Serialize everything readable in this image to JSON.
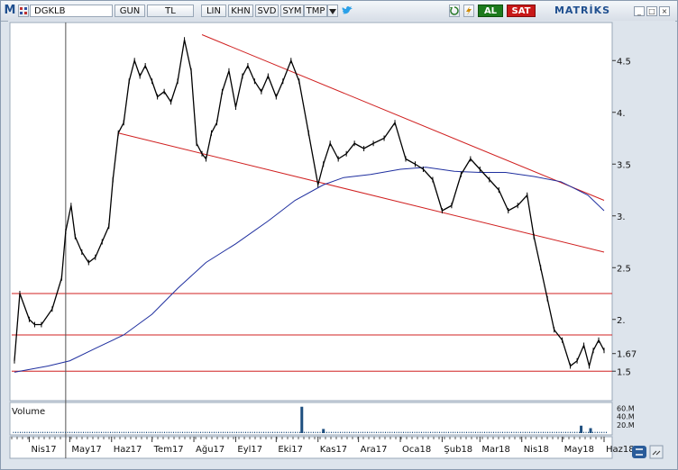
{
  "toolbar": {
    "logo": "M",
    "symbol": "DGKLB",
    "period": "GUN",
    "currency": "TL",
    "buttons": [
      "LIN",
      "KHN",
      "SVD",
      "SYM",
      "TMP"
    ],
    "buy_label": "AL",
    "sell_label": "SAT",
    "brand": "MATRİKS",
    "refresh_icon": "refresh-icon",
    "twitter_icon": "twitter-bird-icon",
    "colors": {
      "buy": "#1c7a1c",
      "sell": "#c81818",
      "accent": "#1f4f8f"
    }
  },
  "chart_data": [
    {
      "type": "line",
      "series": [
        {
          "role": "price",
          "color": "#000000",
          "x": [
            "2017-03-21",
            "2017-03-25",
            "2017-04-01",
            "2017-04-05",
            "2017-04-10",
            "2017-04-18",
            "2017-04-25",
            "2017-04-28",
            "2017-05-02",
            "2017-05-05",
            "2017-05-10",
            "2017-05-15",
            "2017-05-20",
            "2017-05-25",
            "2017-05-30",
            "2017-06-02",
            "2017-06-06",
            "2017-06-10",
            "2017-06-14",
            "2017-06-18",
            "2017-06-22",
            "2017-06-26",
            "2017-07-01",
            "2017-07-05",
            "2017-07-10",
            "2017-07-15",
            "2017-07-20",
            "2017-07-25",
            "2017-07-30",
            "2017-08-03",
            "2017-08-07",
            "2017-08-10",
            "2017-08-14",
            "2017-08-18",
            "2017-08-22",
            "2017-08-27",
            "2017-09-01",
            "2017-09-06",
            "2017-09-10",
            "2017-09-15",
            "2017-09-20",
            "2017-09-25",
            "2017-10-01",
            "2017-10-06",
            "2017-10-12",
            "2017-10-18",
            "2017-10-25",
            "2017-11-01",
            "2017-11-05",
            "2017-11-10",
            "2017-11-16",
            "2017-11-22",
            "2017-11-28",
            "2017-12-05",
            "2017-12-12",
            "2017-12-20",
            "2017-12-28",
            "2018-01-05",
            "2018-01-12",
            "2018-01-18",
            "2018-01-25",
            "2018-02-01",
            "2018-02-08",
            "2018-02-15",
            "2018-02-22",
            "2018-03-01",
            "2018-03-08",
            "2018-03-15",
            "2018-03-22",
            "2018-03-29",
            "2018-04-05",
            "2018-04-10",
            "2018-04-15",
            "2018-04-20",
            "2018-04-25",
            "2018-05-01",
            "2018-05-07",
            "2018-05-12",
            "2018-05-17",
            "2018-05-21",
            "2018-05-24",
            "2018-05-28",
            "2018-06-01"
          ],
          "values": [
            1.6,
            2.25,
            2.0,
            1.95,
            1.95,
            2.1,
            2.4,
            2.85,
            3.1,
            2.8,
            2.65,
            2.55,
            2.6,
            2.75,
            2.9,
            3.35,
            3.8,
            3.9,
            4.3,
            4.5,
            4.35,
            4.45,
            4.3,
            4.15,
            4.2,
            4.1,
            4.3,
            4.7,
            4.4,
            3.7,
            3.6,
            3.55,
            3.8,
            3.9,
            4.2,
            4.4,
            4.05,
            4.35,
            4.45,
            4.3,
            4.2,
            4.35,
            4.15,
            4.3,
            4.5,
            4.3,
            3.8,
            3.3,
            3.5,
            3.7,
            3.55,
            3.6,
            3.7,
            3.65,
            3.7,
            3.75,
            3.9,
            3.55,
            3.5,
            3.45,
            3.35,
            3.05,
            3.1,
            3.4,
            3.55,
            3.45,
            3.35,
            3.25,
            3.05,
            3.1,
            3.2,
            2.8,
            2.5,
            2.2,
            1.9,
            1.8,
            1.55,
            1.6,
            1.75,
            1.55,
            1.7,
            1.8,
            1.7
          ]
        },
        {
          "role": "moving-average",
          "color": "#1f2f9f",
          "x": [
            "2017-03-21",
            "2017-04-15",
            "2017-05-01",
            "2017-05-20",
            "2017-06-10",
            "2017-07-01",
            "2017-07-20",
            "2017-08-10",
            "2017-09-01",
            "2017-09-25",
            "2017-10-15",
            "2017-11-05",
            "2017-11-20",
            "2017-12-10",
            "2018-01-01",
            "2018-01-20",
            "2018-02-10",
            "2018-03-01",
            "2018-03-20",
            "2018-04-10",
            "2018-04-30",
            "2018-05-20",
            "2018-06-01"
          ],
          "values": [
            1.49,
            1.55,
            1.6,
            1.72,
            1.85,
            2.05,
            2.3,
            2.55,
            2.73,
            2.95,
            3.15,
            3.3,
            3.37,
            3.4,
            3.45,
            3.47,
            3.43,
            3.42,
            3.42,
            3.38,
            3.33,
            3.2,
            3.05
          ]
        }
      ],
      "reference_lines": [
        {
          "kind": "horizontal",
          "y": 2.25,
          "color": "#d02020"
        },
        {
          "kind": "horizontal",
          "y": 1.85,
          "color": "#d02020"
        },
        {
          "kind": "horizontal",
          "y": 1.5,
          "color": "#d02020"
        },
        {
          "kind": "trend",
          "from": [
            "2017-08-07",
            4.75
          ],
          "to": [
            "2018-06-01",
            3.15
          ],
          "color": "#d02020"
        },
        {
          "kind": "trend",
          "from": [
            "2017-06-06",
            3.8
          ],
          "to": [
            "2018-06-01",
            2.65
          ],
          "color": "#d02020"
        },
        {
          "kind": "vertical",
          "x": "2017-04-28",
          "color": "#555555"
        }
      ],
      "last_value": "1.67",
      "y_ticks": [
        "4.5",
        "4.",
        "3.5",
        "3.",
        "2.5",
        "2.",
        "1.67",
        "1.5"
      ],
      "x_ticks": [
        "Nis17",
        "May17",
        "Haz17",
        "Tem17",
        "Ağu17",
        "Eyl17",
        "Eki17",
        "Kas17",
        "Ara17",
        "Oca18",
        "Şub18",
        "Mar18",
        "Nis18",
        "May18",
        "Haz18"
      ],
      "grid": false
    },
    {
      "type": "bar",
      "title": "Volume",
      "y_ticks": [
        "60.M",
        "40.M",
        "20.M"
      ],
      "description_values": [
        {
          "x": "2017-10-20",
          "value": 64
        },
        {
          "x": "2017-11-05",
          "value": 10
        },
        {
          "x": "2018-05-15",
          "value": 18
        },
        {
          "x": "2018-05-22",
          "value": 12
        }
      ],
      "baseline_value": 3,
      "color": "#1f4f7f"
    }
  ]
}
